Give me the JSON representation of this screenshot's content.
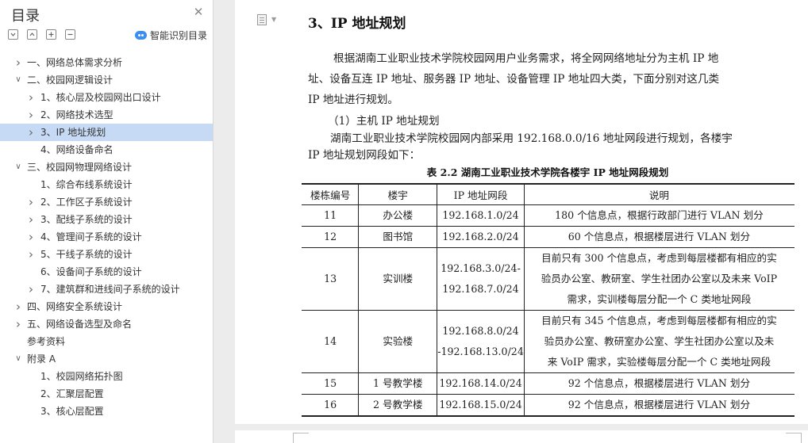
{
  "sidebar": {
    "title": "目录",
    "smart_toc_label": "智能识别目录",
    "items": [
      {
        "label": "一、网络总体需求分析",
        "level": 0,
        "expanded": false,
        "has_children": true
      },
      {
        "label": "二、校园网逻辑设计",
        "level": 0,
        "expanded": true,
        "has_children": true
      },
      {
        "label": "1、核心层及校园网出口设计",
        "level": 1,
        "expanded": false,
        "has_children": true
      },
      {
        "label": "2、网络技术选型",
        "level": 1,
        "expanded": false,
        "has_children": true
      },
      {
        "label": "3、IP 地址规划",
        "level": 1,
        "expanded": false,
        "has_children": true,
        "active": true
      },
      {
        "label": "4、网络设备命名",
        "level": 1,
        "expanded": false,
        "has_children": false
      },
      {
        "label": "三、校园网物理网络设计",
        "level": 0,
        "expanded": true,
        "has_children": true
      },
      {
        "label": "1、综合布线系统设计",
        "level": 1,
        "expanded": false,
        "has_children": false
      },
      {
        "label": "2、工作区子系统设计",
        "level": 1,
        "expanded": false,
        "has_children": true
      },
      {
        "label": "3、配线子系统的设计",
        "level": 1,
        "expanded": false,
        "has_children": true
      },
      {
        "label": "4、管理间子系统的设计",
        "level": 1,
        "expanded": false,
        "has_children": true
      },
      {
        "label": "5、干线子系统的设计",
        "level": 1,
        "expanded": false,
        "has_children": true
      },
      {
        "label": "6、设备间子系统的设计",
        "level": 1,
        "expanded": false,
        "has_children": false
      },
      {
        "label": "7、建筑群和进线间子系统的设计",
        "level": 1,
        "expanded": false,
        "has_children": true
      },
      {
        "label": "四、网络安全系统设计",
        "level": 0,
        "expanded": false,
        "has_children": true
      },
      {
        "label": "五、网络设备选型及命名",
        "level": 0,
        "expanded": false,
        "has_children": true
      },
      {
        "label": "参考资料",
        "level": 0,
        "expanded": false,
        "has_children": false
      },
      {
        "label": "附录 A",
        "level": 0,
        "expanded": true,
        "has_children": true
      },
      {
        "label": "1、校园网络拓扑图",
        "level": 1,
        "expanded": false,
        "has_children": false
      },
      {
        "label": "2、汇聚层配置",
        "level": 1,
        "expanded": false,
        "has_children": false
      },
      {
        "label": "3、核心层配置",
        "level": 1,
        "expanded": false,
        "has_children": false
      }
    ]
  },
  "document": {
    "heading": "3、IP 地址规划",
    "para1_lines": [
      "根据湖南工业职业技术学院校园网用户业务需求，将全网网络地址分为主机 IP 地",
      "址、设备互连 IP 地址、服务器 IP 地址、设备管理 IP 地址四大类，下面分别对这几类",
      "IP 地址进行规划。"
    ],
    "subheading": "（1）主机 IP 地址规划",
    "para2_lines": [
      "湖南工业职业技术学院校园网内部采用 192.168.0.0/16 地址网段进行规划，各楼宇",
      "IP 地址规划网段如下："
    ],
    "table_caption": "表 2.2 湖南工业职业技术学院各楼宇 IP 地址网段规划",
    "table": {
      "headers": [
        "楼栋编号",
        "楼宇",
        "IP 地址网段",
        "说明"
      ],
      "rows": [
        {
          "id": "11",
          "building": "办公楼",
          "ip": [
            "192.168.1.0/24"
          ],
          "desc": [
            "180 个信息点，根据行政部门进行 VLAN 划分"
          ]
        },
        {
          "id": "12",
          "building": "图书馆",
          "ip": [
            "192.168.2.0/24"
          ],
          "desc": [
            "60 个信息点，根据楼层进行 VLAN 划分"
          ]
        },
        {
          "id": "13",
          "building": "实训楼",
          "ip": [
            "192.168.3.0/24-",
            "192.168.7.0/24"
          ],
          "desc": [
            "目前只有 300 个信息点，考虑到每层楼都有相应的实",
            "验员办公室、教研室、学生社团办公室以及未来 VoIP",
            "需求，实训楼每层分配一个 C 类地址网段"
          ]
        },
        {
          "id": "14",
          "building": "实验楼",
          "ip": [
            "192.168.8.0/24",
            "-192.168.13.0/24"
          ],
          "desc": [
            "目前只有 345 个信息点，考虑到每层楼都有相应的实",
            "验员办公室、教研室办公室、学生社团办公室以及未",
            "来 VoIP 需求，实验楼每层分配一个 C 类地址网段"
          ]
        },
        {
          "id": "15",
          "building": "1 号教学楼",
          "ip": [
            "192.168.14.0/24"
          ],
          "desc": [
            "92 个信息点，根据楼层进行 VLAN 划分"
          ]
        },
        {
          "id": "16",
          "building": "2 号教学楼",
          "ip": [
            "192.168.15.0/24"
          ],
          "desc": [
            "92 个信息点，根据楼层进行 VLAN 划分"
          ]
        }
      ]
    }
  }
}
